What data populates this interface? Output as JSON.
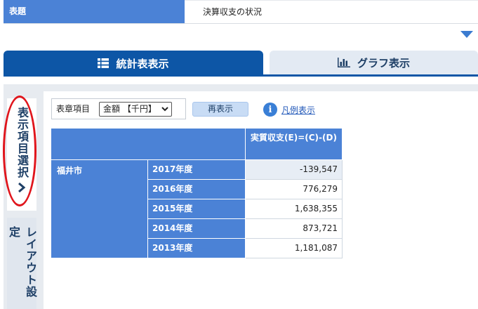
{
  "header": {
    "label": "表題",
    "value": "決算収支の状況"
  },
  "tabs": [
    {
      "label": "統計表表示",
      "active": true,
      "icon": "list-icon"
    },
    {
      "label": "グラフ表示",
      "active": false,
      "icon": "bar-chart-icon"
    }
  ],
  "side_tabs": [
    {
      "label": "表示項目選択"
    },
    {
      "label": "レイアウト設定"
    }
  ],
  "toolbar": {
    "selector_label": "表章項目",
    "selected": "金額 【千円】",
    "redisplay_label": "再表示",
    "legend_label": "凡例表示"
  },
  "table": {
    "column_header": "実質収支(E)=(C)-(D)",
    "region": "福井市",
    "rows": [
      {
        "year": "2017年度",
        "value": "-139,547"
      },
      {
        "year": "2016年度",
        "value": "776,279"
      },
      {
        "year": "2015年度",
        "value": "1,638,355"
      },
      {
        "year": "2014年度",
        "value": "873,721"
      },
      {
        "year": "2013年度",
        "value": "1,181,087"
      }
    ]
  },
  "colors": {
    "primary": "#0d56a6",
    "header_blue": "#4b82d6",
    "highlight": "#e0151c"
  }
}
